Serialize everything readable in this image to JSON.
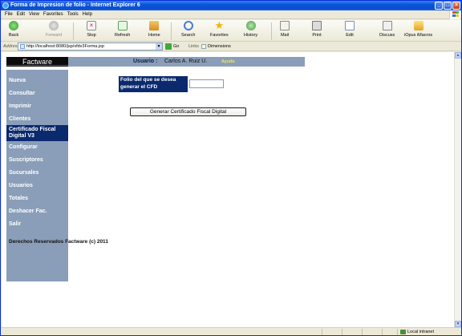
{
  "window": {
    "title": "Forma de Impresion de folio - Internet Explorer 6"
  },
  "menu": [
    "File",
    "Edit",
    "View",
    "Favorites",
    "Tools",
    "Help"
  ],
  "toolbar": {
    "back": "Back",
    "forward": "Forward",
    "stop": "Stop",
    "refresh": "Refresh",
    "home": "Home",
    "search": "Search",
    "favorites": "Favorites",
    "history": "History",
    "mail": "Mail",
    "print": "Print",
    "edit": "Edit",
    "discuss": "Discuss",
    "icopus": "iOpus iMacros"
  },
  "address": {
    "label": "Address",
    "url": "http://localhost:8080/jsp/xfdv3Forma.jsp",
    "go": "Go",
    "links": "Links",
    "link1": "Dimensions"
  },
  "header": {
    "brand": "Factware",
    "user_label": "Usuario :",
    "user_name": "Carlos  A.  Ruiz  U.",
    "help": "Ayuda"
  },
  "sidebar": {
    "items": [
      "Nueva",
      "Consultar",
      "Imprimir",
      "Clientes",
      "Certificado Fiscal",
      "Digital V3",
      "Configurar",
      "Suscriptores",
      "Sucursales",
      "Usuarios",
      "Totales",
      "Deshacer Fac.",
      "Salir"
    ],
    "active": "Certificado Fiscal Digital V3"
  },
  "form": {
    "folio_label_line1": "Folio del que se desea",
    "folio_label_line2": "generar el CFD",
    "folio_value": "",
    "submit": "Generar Certificado Fiscal Digital"
  },
  "footer": {
    "copyright": "Derechos Reservados Factware (c) 2011"
  },
  "status": {
    "zone": "Local intranet"
  }
}
